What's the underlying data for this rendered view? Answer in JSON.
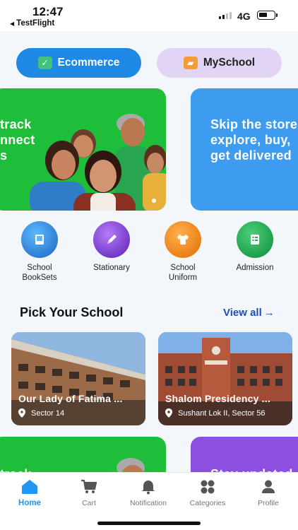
{
  "status_bar": {
    "time": "12:47",
    "back_app": "TestFlight",
    "network": "4G"
  },
  "toggle": {
    "left_label": "Ecommerce",
    "right_label": "MySchool",
    "left_icon": "check-box-icon",
    "right_icon": "book-icon"
  },
  "banners": [
    {
      "text": "track\nnnect\ns",
      "color": "#1fbe3a"
    },
    {
      "text": "Skip the store\nexplore, buy,\nget delivered",
      "color": "#3d9cf0"
    }
  ],
  "categories": [
    {
      "label": "School\nBookSets",
      "icon": "book-icon",
      "color": "#1e88e5"
    },
    {
      "label": "Stationary",
      "icon": "pen-icon",
      "color": "#7b3fd6"
    },
    {
      "label": "School\nUniform",
      "icon": "shirt-icon",
      "color": "#f08a1c"
    },
    {
      "label": "Admission",
      "icon": "form-icon",
      "color": "#1ea94e"
    }
  ],
  "section": {
    "title": "Pick Your School",
    "view_all": "View all"
  },
  "schools": [
    {
      "name": "Our Lady of Fatima ...",
      "location": "Sector 14"
    },
    {
      "name": "Shalom Presidency ...",
      "location": "Sushant Lok II, Sector 56"
    }
  ],
  "lower_banners": [
    {
      "text": "track"
    },
    {
      "text": "Stay updated"
    }
  ],
  "nav": {
    "items": [
      {
        "label": "Home",
        "icon": "home-icon"
      },
      {
        "label": "Cart",
        "icon": "cart-icon"
      },
      {
        "label": "Notification",
        "icon": "bell-icon"
      },
      {
        "label": "Categories",
        "icon": "grid-icon"
      },
      {
        "label": "Profile",
        "icon": "user-icon"
      }
    ]
  }
}
